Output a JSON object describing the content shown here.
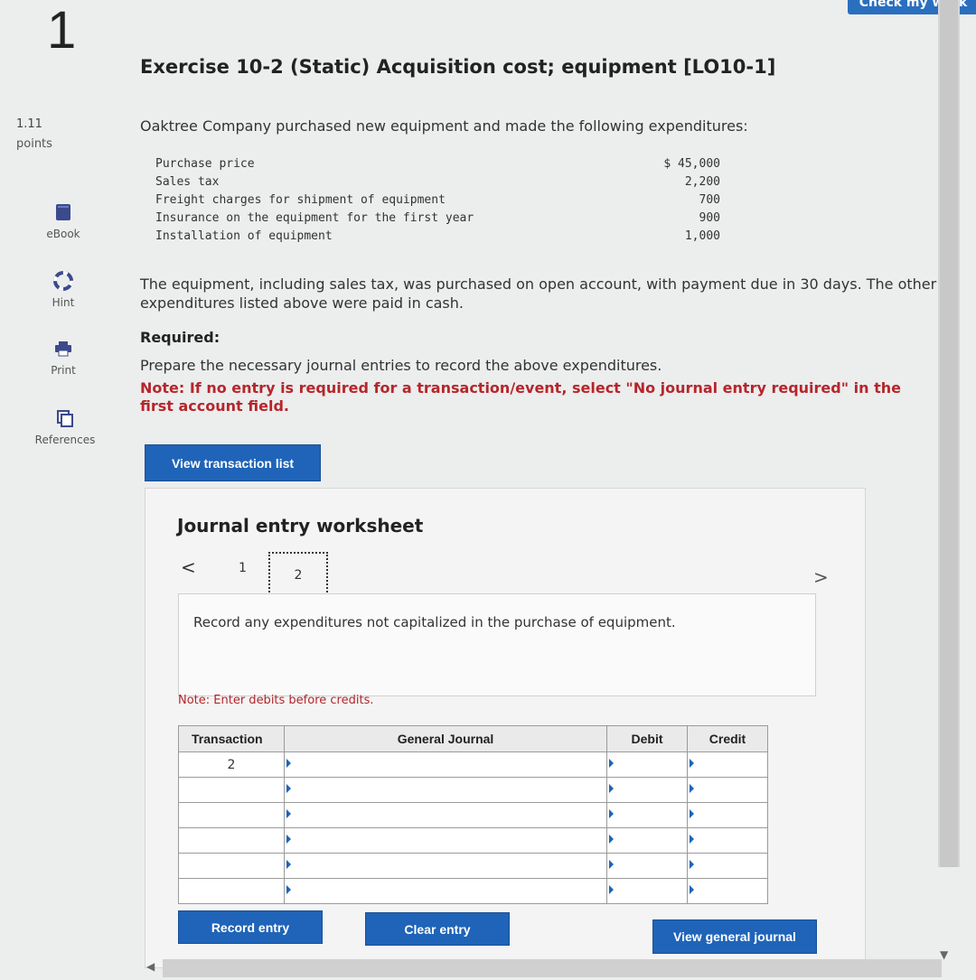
{
  "header": {
    "question_number": "1",
    "check_work_label": "Check my work",
    "title": "Exercise 10-2 (Static) Acquisition cost; equipment [LO10-1]"
  },
  "sidebar": {
    "points_value": "1.11",
    "points_label": "points",
    "items": [
      {
        "label": "eBook",
        "icon": "book-icon"
      },
      {
        "label": "Hint",
        "icon": "lifebuoy-icon"
      },
      {
        "label": "Print",
        "icon": "printer-icon"
      },
      {
        "label": "References",
        "icon": "copy-icon"
      }
    ]
  },
  "problem": {
    "intro": "Oaktree Company purchased new equipment and made the following expenditures:",
    "expenditures": [
      {
        "label": "Purchase price",
        "amount": "$ 45,000"
      },
      {
        "label": "Sales tax",
        "amount": "2,200"
      },
      {
        "label": "Freight charges for shipment of equipment",
        "amount": "700"
      },
      {
        "label": "Insurance on the equipment for the first year",
        "amount": "900"
      },
      {
        "label": "Installation of equipment",
        "amount": "1,000"
      }
    ],
    "paragraph": "The equipment, including sales tax, was purchased on open account, with payment due in 30 days. The other expenditures listed above were paid in cash.",
    "required_heading": "Required:",
    "required_text": "Prepare the necessary journal entries to record the above expenditures.",
    "note": "Note: If no entry is required for a transaction/event, select \"No journal entry required\" in the first account field."
  },
  "buttons": {
    "view_transaction_list": "View transaction list",
    "record_entry": "Record entry",
    "clear_entry": "Clear entry",
    "view_general_journal": "View general journal"
  },
  "worksheet": {
    "title": "Journal entry worksheet",
    "pager_prev": "<",
    "pager_next": ">",
    "pages": [
      "1",
      "2"
    ],
    "current_page": "2",
    "instruction": "Record any expenditures not capitalized in the purchase of equipment.",
    "note": "Note: Enter debits before credits."
  },
  "journal_table": {
    "headers": [
      "Transaction",
      "General Journal",
      "Debit",
      "Credit"
    ],
    "rows": [
      {
        "transaction": "2"
      },
      {
        "transaction": ""
      },
      {
        "transaction": ""
      },
      {
        "transaction": ""
      },
      {
        "transaction": ""
      },
      {
        "transaction": ""
      }
    ]
  }
}
